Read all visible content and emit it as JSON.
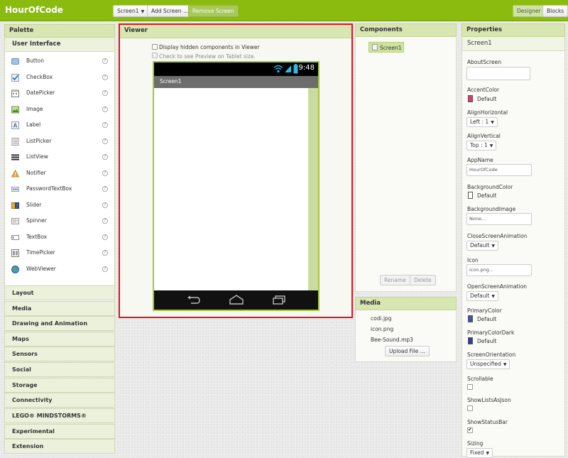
{
  "app": {
    "title": "HourOfCode",
    "screen_dropdown": "Screen1",
    "add_screen": "Add Screen ...",
    "remove_screen": "Remove Screen",
    "designer": "Designer",
    "blocks": "Blocks"
  },
  "palette": {
    "header": "Palette",
    "category_open": "User Interface",
    "items": [
      {
        "label": "Button",
        "icon": "button-icon"
      },
      {
        "label": "CheckBox",
        "icon": "checkbox-icon"
      },
      {
        "label": "DatePicker",
        "icon": "datepicker-icon"
      },
      {
        "label": "Image",
        "icon": "image-icon"
      },
      {
        "label": "Label",
        "icon": "label-icon"
      },
      {
        "label": "ListPicker",
        "icon": "listpicker-icon"
      },
      {
        "label": "ListView",
        "icon": "listview-icon"
      },
      {
        "label": "Notifier",
        "icon": "notifier-icon"
      },
      {
        "label": "PasswordTextBox",
        "icon": "password-icon"
      },
      {
        "label": "Slider",
        "icon": "slider-icon"
      },
      {
        "label": "Spinner",
        "icon": "spinner-icon"
      },
      {
        "label": "TextBox",
        "icon": "textbox-icon"
      },
      {
        "label": "TimePicker",
        "icon": "timepicker-icon"
      },
      {
        "label": "WebViewer",
        "icon": "webviewer-icon"
      }
    ],
    "help_glyph": "?",
    "categories": [
      "Layout",
      "Media",
      "Drawing and Animation",
      "Maps",
      "Sensors",
      "Social",
      "Storage",
      "Connectivity",
      "LEGO® MINDSTORMS®",
      "Experimental",
      "Extension"
    ]
  },
  "viewer": {
    "header": "Viewer",
    "hidden_components": "Display hidden components in Viewer",
    "tablet_preview": "Check to see Preview on Tablet size.",
    "phone_time": "9:48",
    "screen_title": "Screen1"
  },
  "components": {
    "header": "Components",
    "tree_root": "Screen1",
    "rename": "Rename",
    "delete": "Delete"
  },
  "media": {
    "header": "Media",
    "files": [
      "codi.jpg",
      "icon.png",
      "Bee-Sound.mp3"
    ],
    "upload": "Upload File ..."
  },
  "properties": {
    "header": "Properties",
    "component": "Screen1",
    "about_screen_label": "AboutScreen",
    "accent_color_label": "AccentColor",
    "accent_color_value": "Default",
    "accent_color_swatch": "#e8336a",
    "align_h_label": "AlignHorizontal",
    "align_h_value": "Left : 1",
    "align_v_label": "AlignVertical",
    "align_v_value": "Top : 1",
    "app_name_label": "AppName",
    "app_name_value": "HourOfCode",
    "bg_color_label": "BackgroundColor",
    "bg_color_value": "Default",
    "bg_color_swatch": "#ffffff",
    "bg_image_label": "BackgroundImage",
    "bg_image_value": "None...",
    "close_anim_label": "CloseScreenAnimation",
    "close_anim_value": "Default",
    "icon_label": "Icon",
    "icon_value": "icon.png...",
    "open_anim_label": "OpenScreenAnimation",
    "open_anim_value": "Default",
    "primary_color_label": "PrimaryColor",
    "primary_color_value": "Default",
    "primary_color_swatch": "#3f51b5",
    "primary_dark_label": "PrimaryColorDark",
    "primary_dark_value": "Default",
    "primary_dark_swatch": "#303f9f",
    "orientation_label": "ScreenOrientation",
    "orientation_value": "Unspecified",
    "scrollable_label": "Scrollable",
    "lists_json_label": "ShowListsAsJson",
    "status_bar_label": "ShowStatusBar",
    "sizing_label": "Sizing",
    "sizing_value": "Fixed"
  }
}
